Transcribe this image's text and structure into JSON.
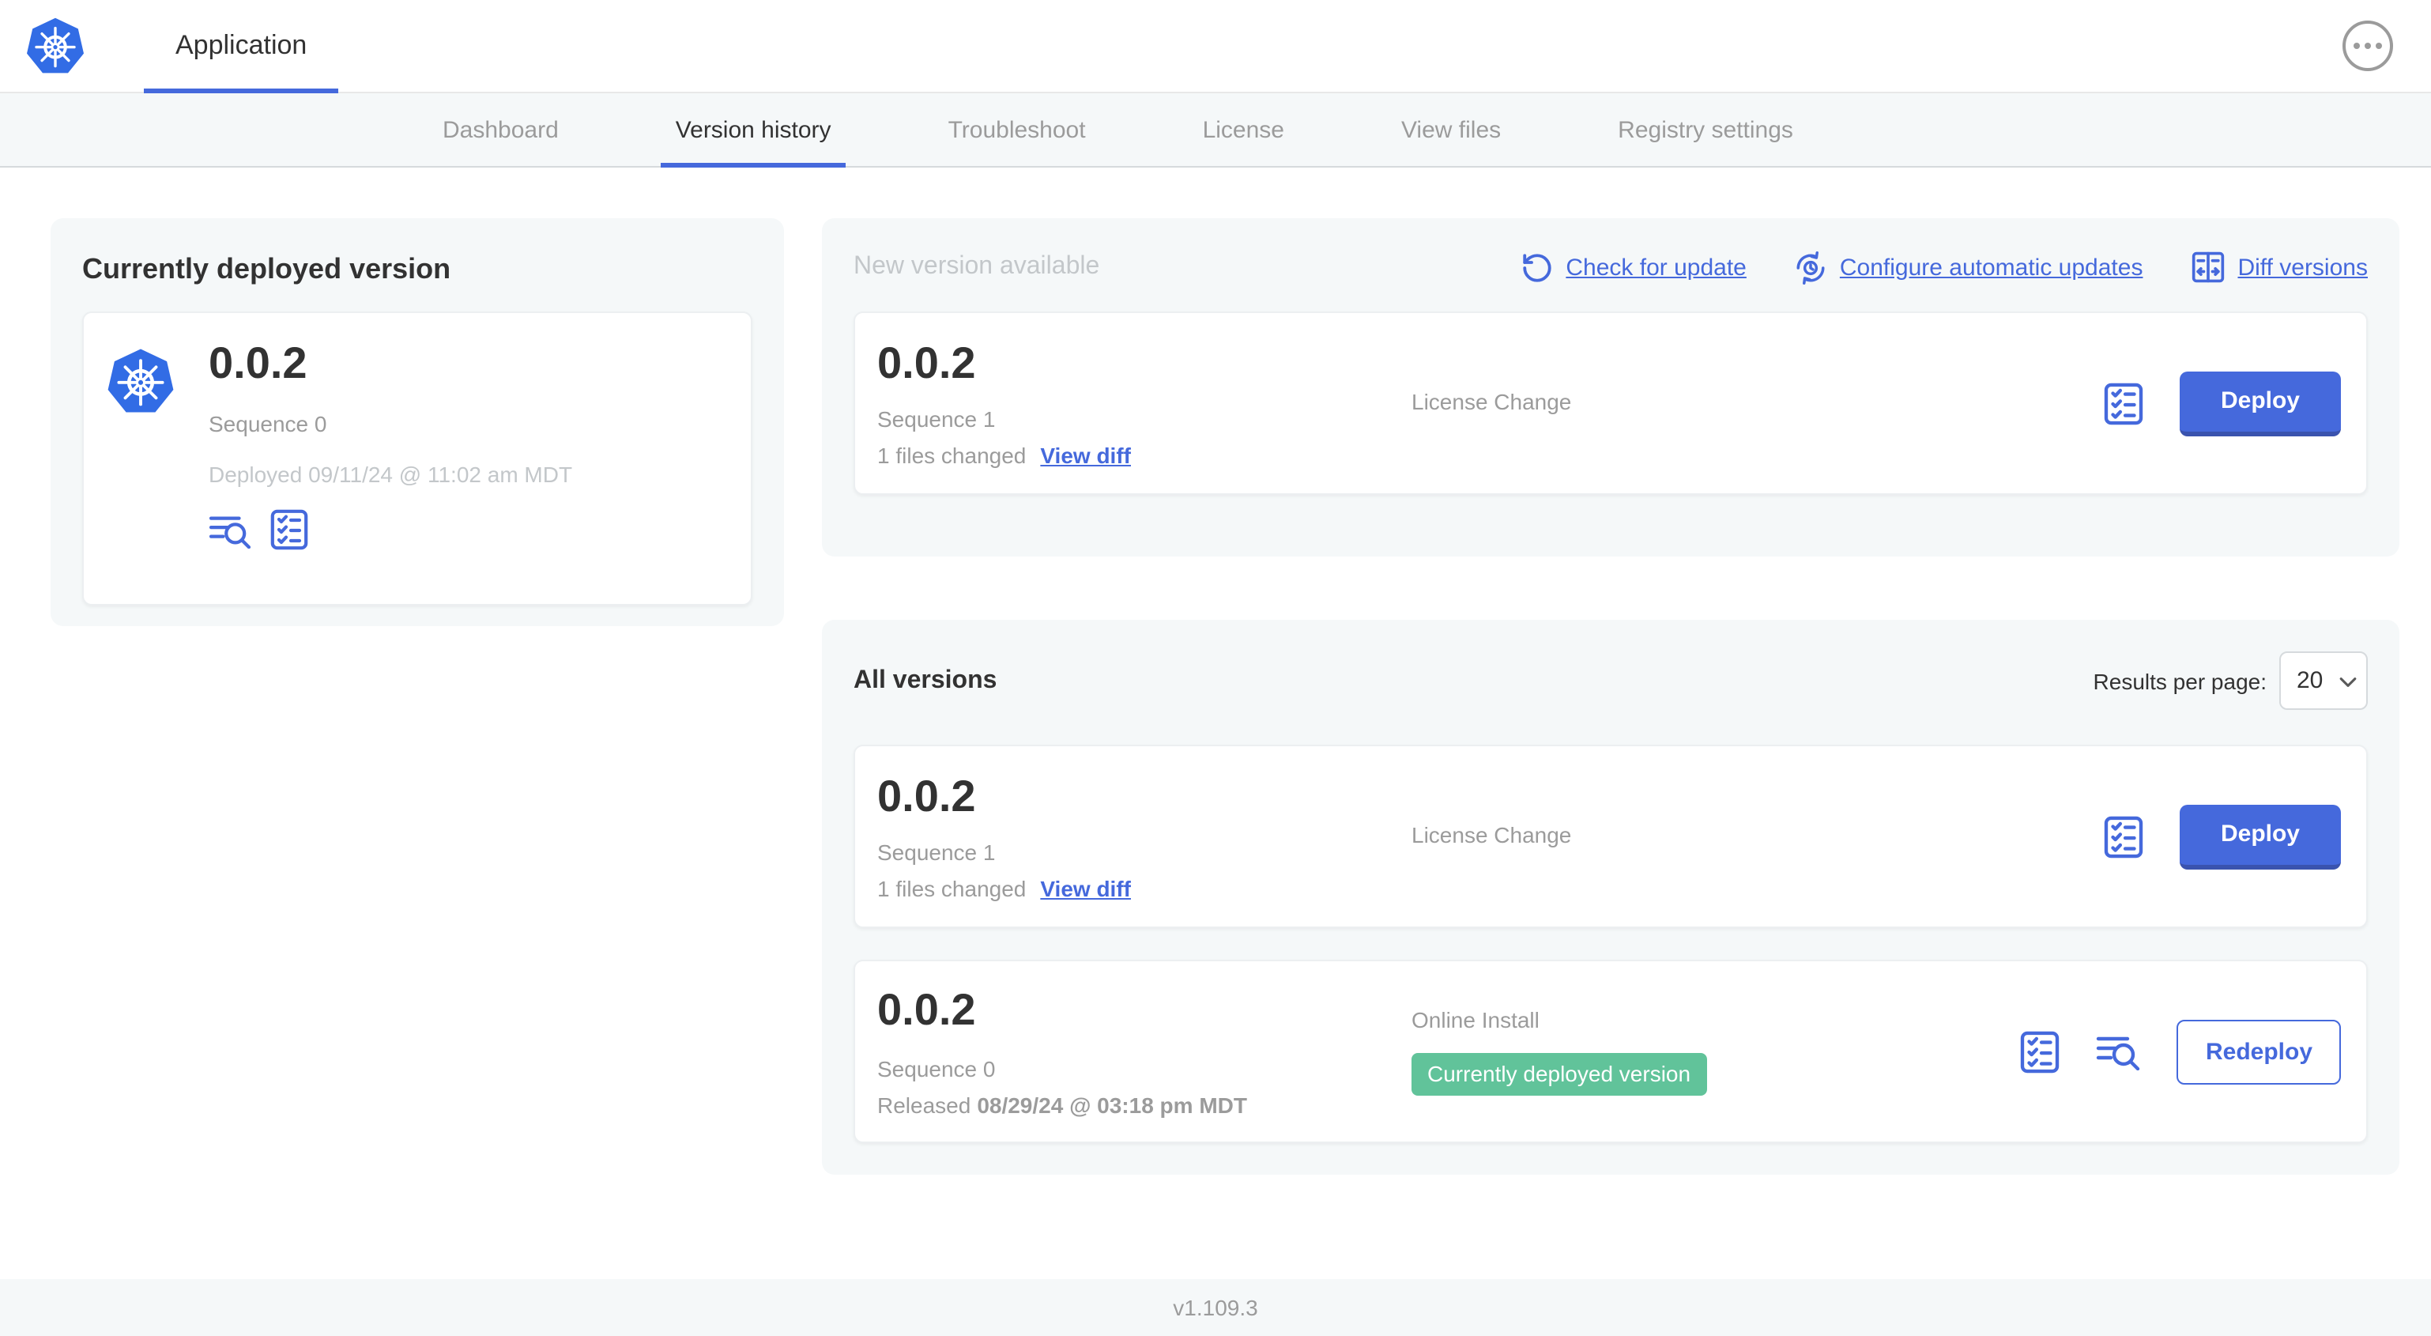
{
  "colors": {
    "accent_blue": "#4569DC",
    "accent_blue_dark": "#3A53AE",
    "kubernetes_blue": "#326CE5",
    "badge_green": "#61C39A",
    "text_dark": "#323232",
    "text_gray": "#9B9B9B",
    "text_muted": "#C3C7CA",
    "card_bg": "#F5F8F9"
  },
  "header": {
    "title": "Application",
    "more_menu_icon": "ellipsis-icon"
  },
  "nav": {
    "tabs": [
      "Dashboard",
      "Version history",
      "Troubleshoot",
      "License",
      "View files",
      "Registry settings"
    ],
    "active_tab": "Version history"
  },
  "deployed": {
    "title": "Currently deployed version",
    "version": "0.0.2",
    "sequence": "Sequence 0",
    "deployed_at": "Deployed 09/11/24 @ 11:02 am MDT",
    "icons": [
      "view-logs-icon",
      "preflight-checklist-icon"
    ]
  },
  "new_version": {
    "title": "New version available",
    "actions": {
      "check": "Check for update",
      "configure": "Configure automatic updates",
      "diff": "Diff versions"
    },
    "action_icons": [
      "refresh-ccw-icon",
      "scheduled-update-icon",
      "diff-columns-icon"
    ],
    "row": {
      "version": "0.0.2",
      "sequence": "Sequence 1",
      "files_changed": "1 files changed",
      "view_diff": "View diff",
      "source": "License Change",
      "action": "Deploy"
    }
  },
  "all_versions": {
    "title": "All versions",
    "results_label": "Results per page:",
    "results_value": "20",
    "rows": [
      {
        "version": "0.0.2",
        "sequence": "Sequence 1",
        "files_changed": "1 files changed",
        "view_diff": "View diff",
        "source": "License Change",
        "action": "Deploy"
      },
      {
        "version": "0.0.2",
        "sequence": "Sequence 0",
        "released_label": "Released",
        "released_date": "08/29/24 @ 03:18 pm MDT",
        "source": "Online Install",
        "badge": "Currently deployed version",
        "action": "Redeploy"
      }
    ]
  },
  "footer": {
    "app_version": "v1.109.3"
  }
}
